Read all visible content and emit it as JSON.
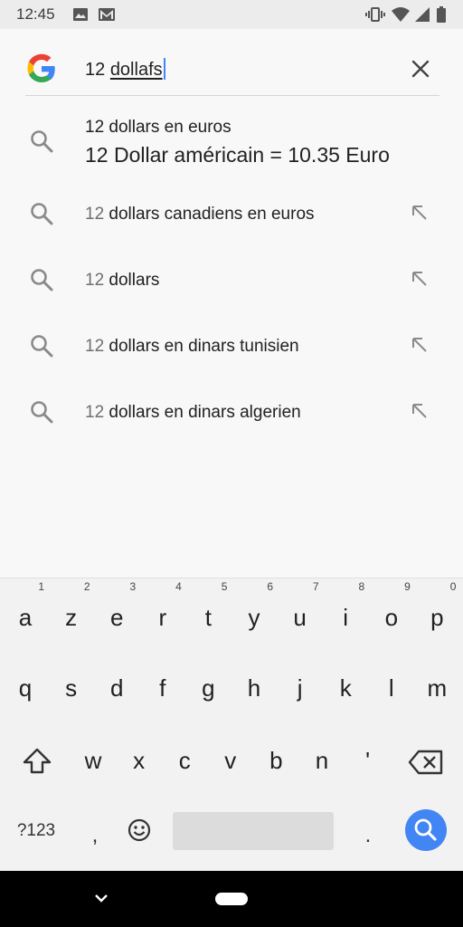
{
  "status_bar": {
    "time": "12:45",
    "left_icons": [
      "image-icon",
      "gmail-icon"
    ],
    "right_icons": [
      "vibrate-icon",
      "wifi-icon",
      "signal-icon",
      "battery-icon"
    ]
  },
  "search": {
    "query_prefix": "12 ",
    "query_typed": "dollafs",
    "clear_icon": "close-icon"
  },
  "answer": {
    "subtitle": "12 dollars en euros",
    "result": "12 Dollar américain = 10.35 Euro"
  },
  "suggestions": [
    {
      "prefix": "12",
      "rest": " dollars canadiens en euros"
    },
    {
      "prefix": "12",
      "rest": " dollars"
    },
    {
      "prefix": "12",
      "rest": " dollars en dinars tunisien"
    },
    {
      "prefix": "12",
      "rest": " dollars en dinars algerien"
    }
  ],
  "keyboard": {
    "row1": [
      "a",
      "z",
      "e",
      "r",
      "t",
      "y",
      "u",
      "i",
      "o",
      "p"
    ],
    "row1_hints": [
      "1",
      "2",
      "3",
      "4",
      "5",
      "6",
      "7",
      "8",
      "9",
      "0"
    ],
    "row2": [
      "q",
      "s",
      "d",
      "f",
      "g",
      "h",
      "j",
      "k",
      "l",
      "m"
    ],
    "row3": [
      "w",
      "x",
      "c",
      "v",
      "b",
      "n",
      "'"
    ],
    "symbols_label": "?123",
    "comma": ",",
    "period": "."
  },
  "colors": {
    "accent": "#4285f4",
    "google_red": "#ea4335",
    "google_yellow": "#fbbc05",
    "google_green": "#34a853"
  }
}
